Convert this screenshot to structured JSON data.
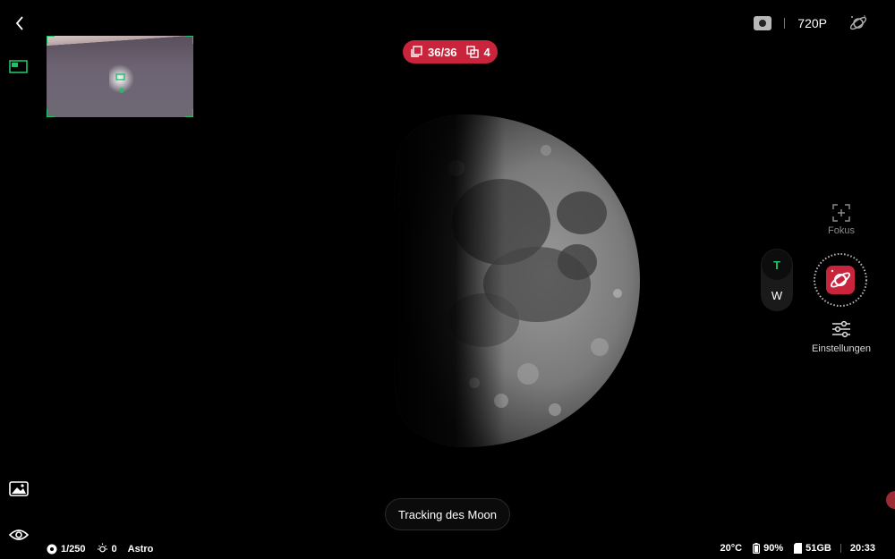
{
  "capture": {
    "frame_counter": "36/36",
    "stack_count": "4"
  },
  "top_bar": {
    "resolution": "720P"
  },
  "controls": {
    "focus_label": "Fokus",
    "zoom_tele": "T",
    "zoom_wide": "W",
    "settings_label": "Einstellungen"
  },
  "toast": {
    "message": "Tracking des Moon"
  },
  "status_left": {
    "shutter": "1/250",
    "exposure_comp": "0",
    "mode": "Astro"
  },
  "status_right": {
    "temperature": "20°C",
    "battery": "90%",
    "storage": "51GB",
    "time": "20:33"
  },
  "colors": {
    "accent_green": "#21c16b",
    "accent_red": "#c8243b",
    "background": "#000000"
  },
  "icons": [
    "back-icon",
    "layout-icon",
    "gallery-icon",
    "eye-icon",
    "stack-icon",
    "frames-icon",
    "camera-icon",
    "planet-icon",
    "focus-icon",
    "shutter-astro-icon",
    "settings-icon",
    "aperture-icon",
    "sun-icon",
    "battery-icon",
    "sd-card-icon"
  ]
}
